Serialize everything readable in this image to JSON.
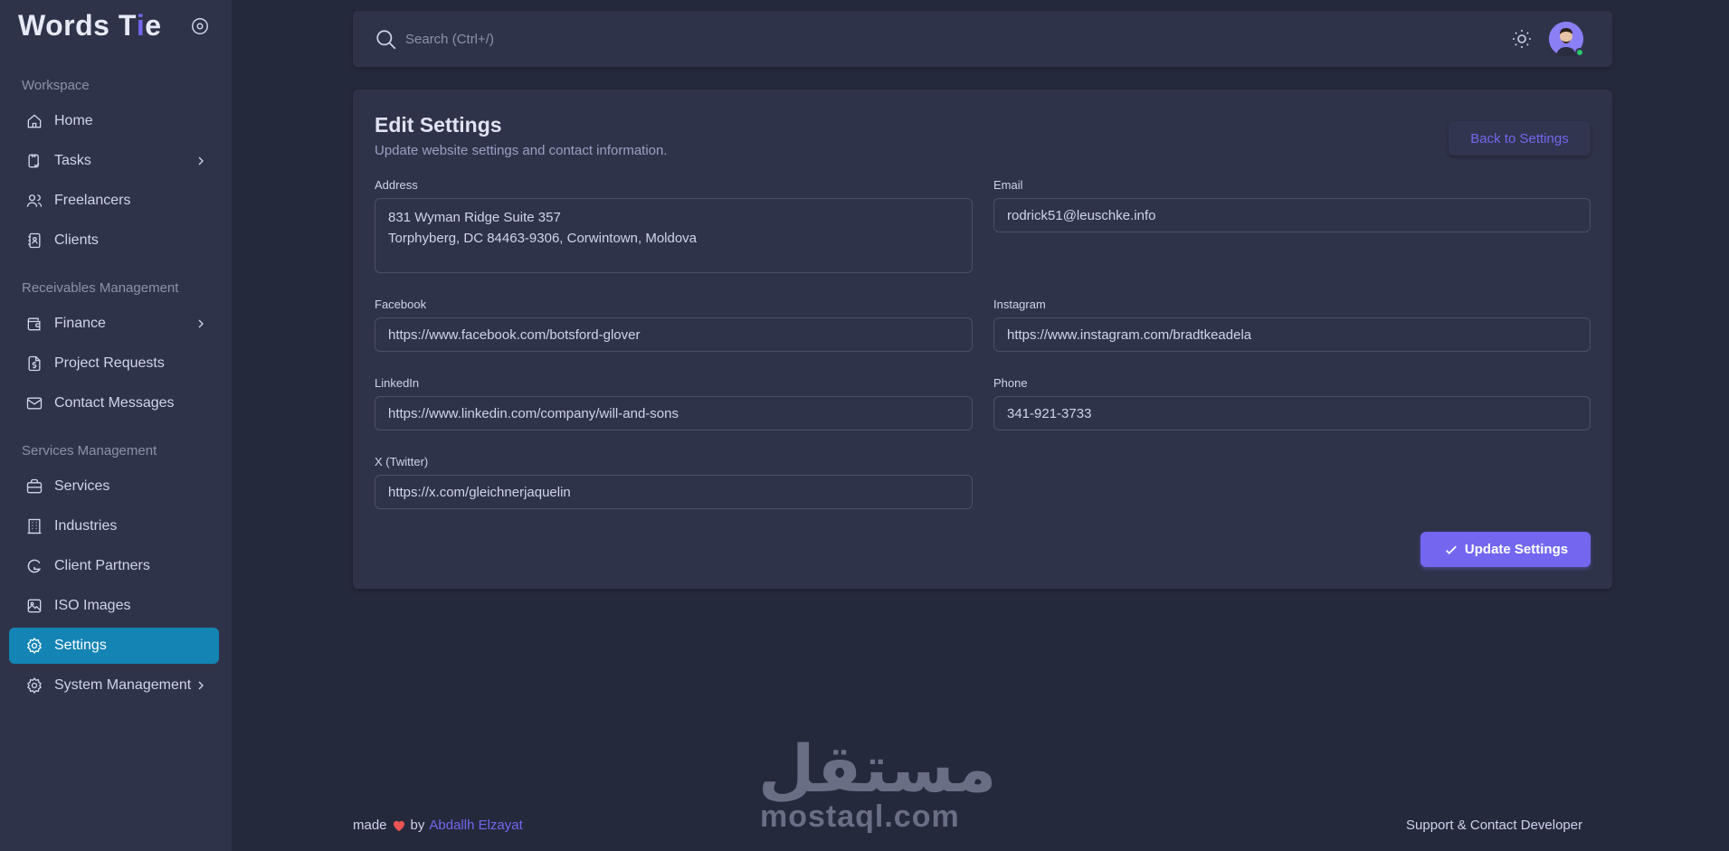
{
  "brand": {
    "name_part1": "Words T",
    "name_accent": "i",
    "name_part2": "e"
  },
  "sidebar": {
    "sections": {
      "workspace": "Workspace",
      "receivables": "Receivables Management",
      "services": "Services Management"
    },
    "items": [
      {
        "label": "Home",
        "icon": "home-icon"
      },
      {
        "label": "Tasks",
        "icon": "clipboard-check-icon",
        "has_submenu": true
      },
      {
        "label": "Freelancers",
        "icon": "users-icon"
      },
      {
        "label": "Clients",
        "icon": "address-book-icon"
      },
      {
        "label": "Finance",
        "icon": "wallet-icon",
        "has_submenu": true
      },
      {
        "label": "Project Requests",
        "icon": "dollar-file-icon"
      },
      {
        "label": "Contact Messages",
        "icon": "mail-icon"
      },
      {
        "label": "Services",
        "icon": "briefcase-icon"
      },
      {
        "label": "Industries",
        "icon": "building-icon"
      },
      {
        "label": "Client Partners",
        "icon": "brand-g-icon"
      },
      {
        "label": "ISO Images",
        "icon": "photo-icon"
      },
      {
        "label": "Settings",
        "icon": "settings-icon",
        "active": true
      },
      {
        "label": "System Management",
        "icon": "settings-icon",
        "has_submenu": true
      }
    ]
  },
  "topbar": {
    "search_placeholder": "Search (Ctrl+/)"
  },
  "page": {
    "title": "Edit Settings",
    "subtitle": "Update website settings and contact information.",
    "back_button": "Back to Settings",
    "submit_button": "Update Settings"
  },
  "form": {
    "address": {
      "label": "Address",
      "line1": "831 Wyman Ridge Suite 357",
      "line2": "Torphyberg, DC 84463-9306, Corwintown, Moldova"
    },
    "email": {
      "label": "Email",
      "value": "rodrick51@leuschke.info"
    },
    "facebook": {
      "label": "Facebook",
      "value": "https://www.facebook.com/botsford-glover"
    },
    "instagram": {
      "label": "Instagram",
      "value": "https://www.instagram.com/bradtkeadela"
    },
    "linkedin": {
      "label": "LinkedIn",
      "value": "https://www.linkedin.com/company/will-and-sons"
    },
    "phone": {
      "label": "Phone",
      "value": "341-921-3733"
    },
    "twitter": {
      "label": "X (Twitter)",
      "value": "https://x.com/gleichnerjaquelin"
    }
  },
  "footer": {
    "made": "made",
    "by": "by",
    "author": "Abdallh Elzayat",
    "support": "Support & Contact Developer"
  },
  "watermark": {
    "arabic": "مستقل",
    "latin": "mostaql.com"
  },
  "colors": {
    "accent": "#7367f0",
    "active_nav": "#1484b4",
    "background": "#25293c",
    "surface": "#2f3349"
  }
}
